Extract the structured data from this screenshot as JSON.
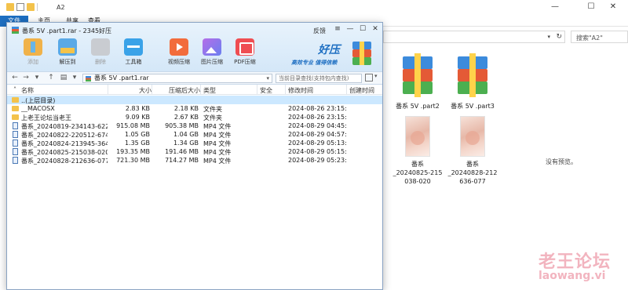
{
  "explorer": {
    "title": "A2",
    "ribbon_tabs": [
      "文件",
      "主页",
      "共享",
      "查看"
    ],
    "search_placeholder": "搜索\"A2\"",
    "tiles": [
      {
        "label": "番系 5V .part2",
        "type": "rar"
      },
      {
        "label": "番系 5V .part3",
        "type": "rar"
      },
      {
        "label_line1": "番系",
        "label_line2": "_20240825-215",
        "label_line3": "038-020",
        "type": "image"
      },
      {
        "label_line1": "番系",
        "label_line2": "_20240828-212",
        "label_line3": "636-077",
        "type": "image"
      }
    ],
    "preview_note": "没有预览。",
    "watermark": "老王论坛",
    "watermark_url": "laowang.vi"
  },
  "haozip": {
    "title": "番系 5V .part1.rar - 2345好压",
    "feedback": "反馈",
    "toolbar": {
      "add": "添加",
      "extract": "解压到",
      "delete": "删除",
      "tools": "工具箱",
      "video": "视频压缩",
      "image": "图片压缩",
      "pdf": "PDF压缩"
    },
    "brand": {
      "name": "好压",
      "slogan": "高效专业  值得信赖"
    },
    "path": "番系 5V .part1.rar",
    "search_placeholder": "当前目录查找(支持包内查找)",
    "columns": {
      "name": "名称",
      "size": "大小",
      "packed": "压缩后大小",
      "type": "类型",
      "security": "安全",
      "modified": "修改时间",
      "created": "创建时间"
    },
    "rows": [
      {
        "icon": "up",
        "name": "..(上层目录)",
        "size": "",
        "packed": "",
        "type": "",
        "modified": ""
      },
      {
        "icon": "folder",
        "name": "__MACOSX",
        "size": "2.83 KB",
        "packed": "2.18 KB",
        "type": "文件夹",
        "modified": "2024-08-26 23:15:..."
      },
      {
        "icon": "folder",
        "name": "上老王论坛当老王",
        "size": "9.09 KB",
        "packed": "2.67 KB",
        "type": "文件夹",
        "modified": "2024-08-26 23:15:..."
      },
      {
        "icon": "mp4",
        "name": "番系_20240819-234143-622....",
        "size": "915.08 MB",
        "packed": "905.38 MB",
        "type": "MP4 文件",
        "modified": "2024-08-29 04:45:..."
      },
      {
        "icon": "mp4",
        "name": "番系_20240822-220512-674....",
        "size": "1.05 GB",
        "packed": "1.04 GB",
        "type": "MP4 文件",
        "modified": "2024-08-29 04:57:..."
      },
      {
        "icon": "mp4",
        "name": "番系_20240824-213945-364....",
        "size": "1.35 GB",
        "packed": "1.34 GB",
        "type": "MP4 文件",
        "modified": "2024-08-29 05:13:..."
      },
      {
        "icon": "mp4",
        "name": "番系_20240825-215038-020....",
        "size": "193.35 MB",
        "packed": "191.46 MB",
        "type": "MP4 文件",
        "modified": "2024-08-29 05:15:..."
      },
      {
        "icon": "mp4",
        "name": "番系_20240828-212636-077....",
        "size": "721.30 MB",
        "packed": "714.27 MB",
        "type": "MP4 文件",
        "modified": "2024-08-29 05:23:..."
      }
    ]
  }
}
